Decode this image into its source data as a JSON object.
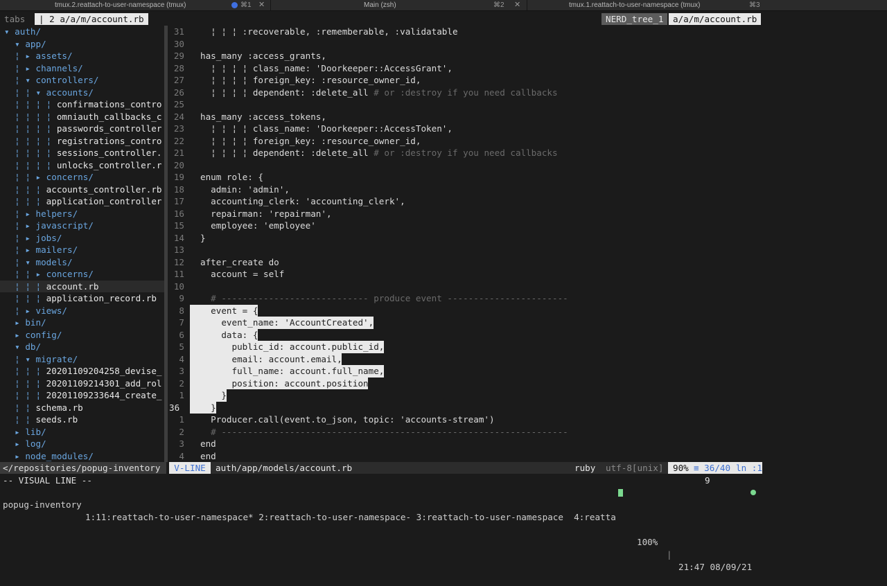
{
  "title_bar": {
    "tab1": {
      "label": "tmux.2.reattach-to-user-namespace (tmux)"
    },
    "tab2": {
      "label": "Main (zsh)",
      "shortcut_left": "⌘1",
      "shortcut": "⌘2"
    },
    "tab3": {
      "label": "tmux.1.reattach-to-user-namespace (tmux)",
      "shortcut": "⌘3"
    },
    "accent": "#3f6fe0"
  },
  "tabline": {
    "tabs_label": "tabs",
    "active_tab": "| 2 a/a/m/account.rb",
    "cursor_mark": "|",
    "nerdtree_label": "NERD_tree_1",
    "right_file": "a/a/m/account.rb"
  },
  "tree": [
    {
      "prefix": "▾ ",
      "name": "auth/",
      "kind": "dir"
    },
    {
      "prefix": "  ▾ ",
      "name": "app/",
      "kind": "dir"
    },
    {
      "prefix": "  ¦ ▸ ",
      "name": "assets/",
      "kind": "dir"
    },
    {
      "prefix": "  ¦ ▸ ",
      "name": "channels/",
      "kind": "dir"
    },
    {
      "prefix": "  ¦ ▾ ",
      "name": "controllers/",
      "kind": "dir"
    },
    {
      "prefix": "  ¦ ¦ ▾ ",
      "name": "accounts/",
      "kind": "dir"
    },
    {
      "prefix": "  ¦ ¦ ¦ ¦ ",
      "name": "confirmations_contro",
      "kind": "file"
    },
    {
      "prefix": "  ¦ ¦ ¦ ¦ ",
      "name": "omniauth_callbacks_c",
      "kind": "file"
    },
    {
      "prefix": "  ¦ ¦ ¦ ¦ ",
      "name": "passwords_controller",
      "kind": "file"
    },
    {
      "prefix": "  ¦ ¦ ¦ ¦ ",
      "name": "registrations_contro",
      "kind": "file"
    },
    {
      "prefix": "  ¦ ¦ ¦ ¦ ",
      "name": "sessions_controller.",
      "kind": "file"
    },
    {
      "prefix": "  ¦ ¦ ¦ ¦ ",
      "name": "unlocks_controller.r",
      "kind": "file"
    },
    {
      "prefix": "  ¦ ¦ ▸ ",
      "name": "concerns/",
      "kind": "dir"
    },
    {
      "prefix": "  ¦ ¦ ¦ ",
      "name": "accounts_controller.rb",
      "kind": "file"
    },
    {
      "prefix": "  ¦ ¦ ¦ ",
      "name": "application_controller",
      "kind": "file"
    },
    {
      "prefix": "  ¦ ▸ ",
      "name": "helpers/",
      "kind": "dir"
    },
    {
      "prefix": "  ¦ ▸ ",
      "name": "javascript/",
      "kind": "dir"
    },
    {
      "prefix": "  ¦ ▸ ",
      "name": "jobs/",
      "kind": "dir"
    },
    {
      "prefix": "  ¦ ▸ ",
      "name": "mailers/",
      "kind": "dir"
    },
    {
      "prefix": "  ¦ ▾ ",
      "name": "models/",
      "kind": "dir"
    },
    {
      "prefix": "  ¦ ¦ ▸ ",
      "name": "concerns/",
      "kind": "dir"
    },
    {
      "prefix": "  ¦ ¦ ¦ ",
      "name": "account.rb",
      "kind": "file",
      "selected": true
    },
    {
      "prefix": "  ¦ ¦ ¦ ",
      "name": "application_record.rb",
      "kind": "file"
    },
    {
      "prefix": "  ¦ ▸ ",
      "name": "views/",
      "kind": "dir"
    },
    {
      "prefix": "  ▸ ",
      "name": "bin/",
      "kind": "dir"
    },
    {
      "prefix": "  ▸ ",
      "name": "config/",
      "kind": "dir"
    },
    {
      "prefix": "  ▾ ",
      "name": "db/",
      "kind": "dir"
    },
    {
      "prefix": "  ¦ ▾ ",
      "name": "migrate/",
      "kind": "dir"
    },
    {
      "prefix": "  ¦ ¦ ¦ ",
      "name": "20201109204258_devise_",
      "kind": "file"
    },
    {
      "prefix": "  ¦ ¦ ¦ ",
      "name": "20201109214301_add_rol",
      "kind": "file"
    },
    {
      "prefix": "  ¦ ¦ ¦ ",
      "name": "20201109233644_create_",
      "kind": "file"
    },
    {
      "prefix": "  ¦ ¦ ",
      "name": "schema.rb",
      "kind": "file"
    },
    {
      "prefix": "  ¦ ¦ ",
      "name": "seeds.rb",
      "kind": "file"
    },
    {
      "prefix": "  ▸ ",
      "name": "lib/",
      "kind": "dir"
    },
    {
      "prefix": "  ▸ ",
      "name": "log/",
      "kind": "dir"
    },
    {
      "prefix": "  ▸ ",
      "name": "node_modules/",
      "kind": "dir"
    }
  ],
  "code": [
    {
      "num": "31",
      "text": "  ¦ ¦ ¦ :recoverable, :rememberable, :validatable"
    },
    {
      "num": "30",
      "text": ""
    },
    {
      "num": "29",
      "text": "has_many :access_grants,"
    },
    {
      "num": "28",
      "text": "  ¦ ¦ ¦ ¦ class_name: 'Doorkeeper::AccessGrant',"
    },
    {
      "num": "27",
      "text": "  ¦ ¦ ¦ ¦ foreign_key: :resource_owner_id,"
    },
    {
      "num": "26",
      "text": "  ¦ ¦ ¦ ¦ dependent: :delete_all",
      "comment": " # or :destroy if you need callbacks"
    },
    {
      "num": "25",
      "text": ""
    },
    {
      "num": "24",
      "text": "has_many :access_tokens,"
    },
    {
      "num": "23",
      "text": "  ¦ ¦ ¦ ¦ class_name: 'Doorkeeper::AccessToken',"
    },
    {
      "num": "22",
      "text": "  ¦ ¦ ¦ ¦ foreign_key: :resource_owner_id,"
    },
    {
      "num": "21",
      "text": "  ¦ ¦ ¦ ¦ dependent: :delete_all",
      "comment": " # or :destroy if you need callbacks"
    },
    {
      "num": "20",
      "text": ""
    },
    {
      "num": "19",
      "text": "enum role: {"
    },
    {
      "num": "18",
      "text": "  admin: 'admin',"
    },
    {
      "num": "17",
      "text": "  accounting_clerk: 'accounting_clerk',"
    },
    {
      "num": "16",
      "text": "  repairman: 'repairman',"
    },
    {
      "num": "15",
      "text": "  employee: 'employee'"
    },
    {
      "num": "14",
      "text": "}"
    },
    {
      "num": "13",
      "text": ""
    },
    {
      "num": "12",
      "text": "after_create do"
    },
    {
      "num": "11",
      "text": "  account = self"
    },
    {
      "num": "10",
      "text": ""
    },
    {
      "num": "9",
      "text": "",
      "comment": "  # ---------------------------- produce event -----------------------"
    },
    {
      "num": "8",
      "text": "  event = {",
      "selected": true
    },
    {
      "num": "7",
      "text": "    event_name: 'AccountCreated',",
      "selected": true
    },
    {
      "num": "6",
      "text": "    data: {",
      "selected": true
    },
    {
      "num": "5",
      "text": "      public_id: account.public_id,",
      "selected": true
    },
    {
      "num": "4",
      "text": "      email: account.email,",
      "selected": true
    },
    {
      "num": "3",
      "text": "      full_name: account.full_name,",
      "selected": true
    },
    {
      "num": "2",
      "text": "      position: account.position",
      "selected": true
    },
    {
      "num": "1",
      "text": "    }",
      "selected": true
    },
    {
      "num": "36",
      "text": "  }",
      "selected": true,
      "current": true
    },
    {
      "num": "1",
      "text": "  Producer.call(event.to_json, topic: 'accounts-stream')"
    },
    {
      "num": "2",
      "text": "",
      "comment": "  # ------------------------------------------------------------------"
    },
    {
      "num": "3",
      "text": "end"
    },
    {
      "num": "4",
      "text": "end"
    }
  ],
  "status": {
    "tree_path": "</repositories/popug-inventory",
    "mode": "V-LINE",
    "file_path": "auth/app/models/account.rb",
    "filetype": "ruby",
    "encoding": "utf-8[unix]",
    "percent": "90%",
    "position": "≡ 36/40",
    "column": "ln :1"
  },
  "command_line": {
    "mode_text": "-- VISUAL LINE --",
    "count": "9"
  },
  "tmux": {
    "session": "popug-inventory",
    "windows": "1:11:reattach-to-user-namespace* 2:reattach-to-user-namespace- 3:reattach-to-user-namespace  4:reatta",
    "battery_icon": "battery-icon",
    "battery": "100%",
    "clock": "21:47 08/09/21",
    "status_color": "#7bd88f"
  }
}
